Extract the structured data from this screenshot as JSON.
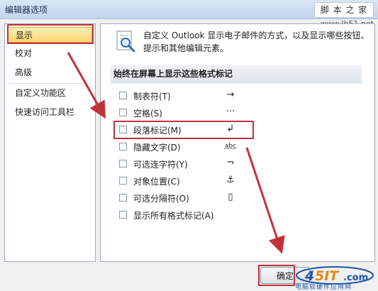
{
  "window": {
    "title": "编辑器选项",
    "watermark_site": "脚 本 之 家",
    "watermark_url": "www.Jb51.net"
  },
  "sidebar": {
    "items": [
      {
        "label": "显示",
        "selected": true
      },
      {
        "label": "校对",
        "selected": false
      },
      {
        "label": "高级",
        "selected": false
      },
      {
        "label": "自定义功能区",
        "selected": false
      },
      {
        "label": "快速访问工具栏",
        "selected": false
      }
    ]
  },
  "main": {
    "description": "自定义 Outlook 显示电子邮件的方式，以及显示哪些按钮、提示和其他编辑元素。",
    "section_title": "始终在屏幕上显示这些格式标记",
    "options": [
      {
        "label": "制表符(T)",
        "mark": "→",
        "checked": false
      },
      {
        "label": "空格(S)",
        "mark": "···",
        "checked": false
      },
      {
        "label": "段落标记(M)",
        "mark": "↲",
        "checked": false
      },
      {
        "label": "隐藏文字(D)",
        "mark": "abc",
        "checked": false
      },
      {
        "label": "可选连字符(Y)",
        "mark": "¬",
        "checked": false
      },
      {
        "label": "对象位置(C)",
        "mark": "⚓",
        "checked": false
      },
      {
        "label": "可选分隔符(O)",
        "mark": "▯",
        "checked": false
      },
      {
        "label": "显示所有格式标记(A)",
        "mark": "",
        "checked": false
      }
    ]
  },
  "footer": {
    "ok_label": "确定",
    "logo_caption": "电脑软硬件应用网"
  },
  "colors": {
    "annotation_red": "#c0313b",
    "selected_fill": "#fad66f",
    "logo_blue": "#1d55a8"
  }
}
